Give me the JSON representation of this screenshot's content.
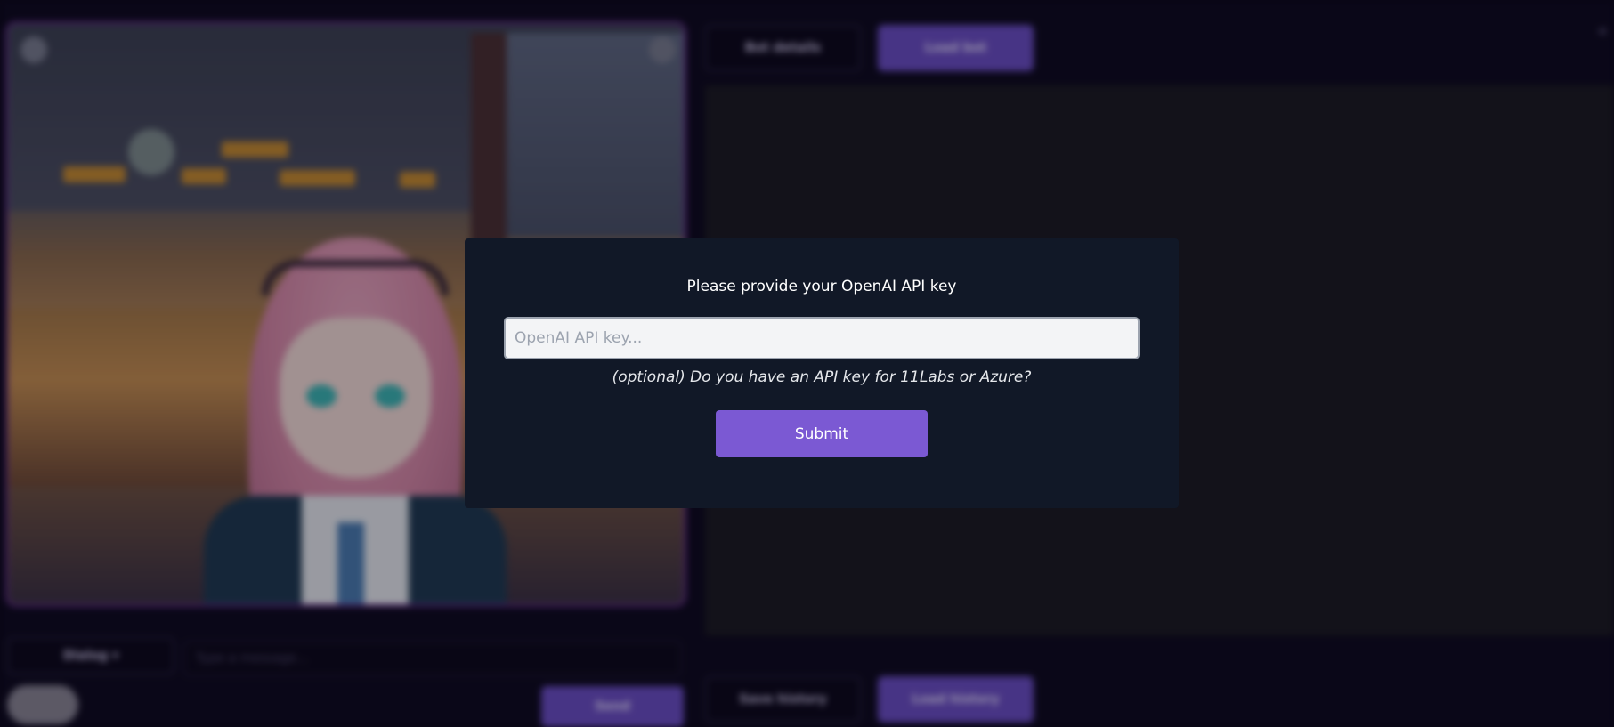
{
  "background": {
    "top_buttons": {
      "bot_details_label": "Bot details",
      "load_bot_label": "Load bot"
    },
    "bottom_buttons": {
      "save_history_label": "Save history",
      "load_history_label": "Load history"
    },
    "controls": {
      "mode_select_value": "Dialog ▾",
      "message_placeholder": "Type a message...",
      "send_label": "Send"
    }
  },
  "modal": {
    "title": "Please provide your OpenAI API key",
    "input_placeholder": "OpenAI API key...",
    "input_value": "",
    "optional_prompt": "(optional) Do you have an API key for 11Labs or Azure?",
    "submit_label": "Submit"
  },
  "colors": {
    "modal_bg": "#111827",
    "accent": "#7b59d3",
    "input_bg": "#f3f4f6"
  }
}
